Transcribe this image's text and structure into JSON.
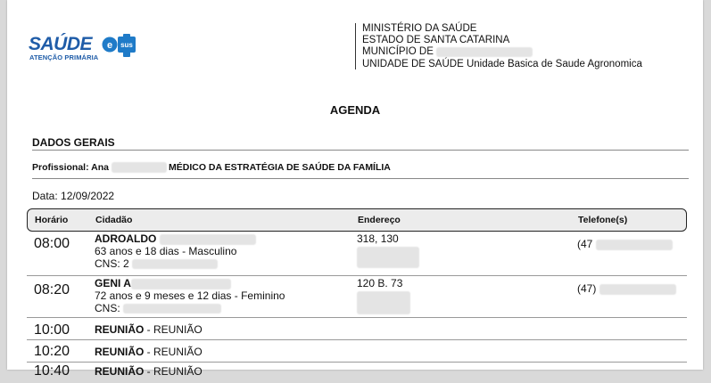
{
  "logo": {
    "word": "SAÚDE",
    "sub": "ATENÇÃO PRIMÁRIA",
    "badge": "sus",
    "badge_color": "#1f7bc8"
  },
  "header": {
    "line1": "MINISTÉRIO DA SAÚDE",
    "line2": "ESTADO DE SANTA CATARINA",
    "line3": "MUNICÍPIO DE",
    "line4_label": "UNIDADE DE SAÚDE",
    "line4_value": "Unidade Basica de Saude Agronomica"
  },
  "title": "AGENDA",
  "section": "DADOS GERAIS",
  "professional": {
    "label": "Profissional: Ana",
    "role": "MÉDICO DA ESTRATÉGIA DE SAÚDE DA FAMÍLIA"
  },
  "date": "Data: 12/09/2022",
  "columns": {
    "time": "Horário",
    "citizen": "Cidadão",
    "address": "Endereço",
    "phone": "Telefone(s)"
  },
  "rows": [
    {
      "time": "08:00",
      "name": "ADROALDO",
      "details": "63 anos e 18 dias - Masculino",
      "cns": "CNS: 2",
      "address": "318, 130",
      "phone": "(47"
    },
    {
      "time": "08:20",
      "name": "GENI A",
      "details": "72 anos e 9 meses e 12 dias - Feminino",
      "cns": "CNS:",
      "address": "120 B. 73",
      "phone": "(47)"
    },
    {
      "time": "10:00",
      "name": "REUNIÃO",
      "suffix": " - REUNIÃO"
    },
    {
      "time": "10:20",
      "name": "REUNIÃO",
      "suffix": " - REUNIÃO"
    },
    {
      "time": "10:40",
      "name": "REUNIÃO",
      "suffix": " - REUNIÃO"
    }
  ]
}
